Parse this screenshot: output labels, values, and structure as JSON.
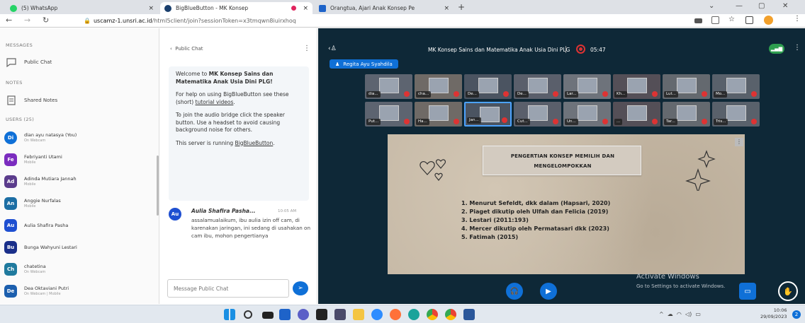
{
  "tabs": [
    {
      "title": "(5) WhatsApp",
      "color": "#25d366"
    },
    {
      "title": "BigBlueButton - MK Konsep",
      "color": "#1a3f6d"
    },
    {
      "title": "Orangtua, Ajari Anak Konsep Pe",
      "color": "#1e63c9"
    }
  ],
  "new_tab": "+",
  "url": {
    "host": "uscamz-1.unsri.ac.id",
    "path": "/html5client/join?sessionToken=x3tmqwn8iuirxhoq"
  },
  "sidebar": {
    "messages_label": "MESSAGES",
    "public_chat": "Public Chat",
    "notes_label": "NOTES",
    "shared_notes": "Shared Notes",
    "users_label": "USERS (25)",
    "users": [
      {
        "initials": "Di",
        "name": "dian ayu natasya (You)",
        "sub": "On Webcam",
        "color": "#0f70d7"
      },
      {
        "initials": "Fe",
        "name": "Febriyanti Utami",
        "sub": "Mobile",
        "color": "#7b2cbf"
      },
      {
        "initials": "Ad",
        "name": "Adinda Mutiara Jannah",
        "sub": "Mobile",
        "color": "#5b3c8c"
      },
      {
        "initials": "An",
        "name": "Anggie Nurfalas",
        "sub": "Mobile",
        "color": "#1c6ea4"
      },
      {
        "initials": "Au",
        "name": "Aulia Shafira Pasha",
        "sub": "",
        "color": "#1e4fd1"
      },
      {
        "initials": "Bu",
        "name": "Bunga Wahyuni Lestari",
        "sub": "",
        "color": "#1a2f8a"
      },
      {
        "initials": "Ch",
        "name": "chatetina",
        "sub": "On Webcam",
        "color": "#1f7a9e"
      },
      {
        "initials": "De",
        "name": "Dea Oktaviani Putri",
        "sub": "On Webcam | Mobile",
        "color": "#1c5fae"
      }
    ]
  },
  "chat": {
    "header": "Public Chat",
    "welcome1_pre": "Welcome to ",
    "welcome1_bold": "MK Konsep Sains dan Matematika Anak Usia Dini PLG",
    "welcome1_post": "!",
    "welcome2_pre": "For help on using BigBlueButton see these (short) ",
    "welcome2_link": "tutorial videos",
    "welcome2_post": ".",
    "welcome3": "To join the audio bridge click the speaker button. Use a headset to avoid causing background noise for others.",
    "welcome4_pre": "This server is running ",
    "welcome4_link": "BigBlueButton",
    "welcome4_post": ".",
    "msg_initials": "Au",
    "msg_name": "Aulia Shafira Pasha...",
    "msg_time": "10:05 AM",
    "msg_text": "assalamualaikum, ibu aulia izin off cam, di karenakan jaringan, ini sedang di usahakan on cam ibu, mohon pengertianya",
    "input_placeholder": "Message Public Chat"
  },
  "meeting": {
    "title": "MK Konsep Sains dan Matematika Anak Usia Dini PLG",
    "rec_time": "05:47",
    "presenter": "Regita Ayu Syahdila",
    "tiles": [
      "dia...",
      "cha...",
      "De...",
      "De...",
      "Lar...",
      "Kh...",
      "Lut...",
      "Mo...",
      "Put...",
      "Ha...",
      "Jan...",
      "Cut...",
      "Un...",
      "...",
      "Tar...",
      "Tris..."
    ],
    "slide_title1": "PENGERTIAN KONSEP MEMILIH DAN",
    "slide_title2": "MENGELOMPOKKAN",
    "slide_items": [
      "1. Menurut Sefeldt, dkk dalam (Hapsari, 2020)",
      "2. Piaget dikutip oleh Ulfah dan Felicia (2019)",
      "3. Lestari (2011:193)",
      "4. Mercer dikutip oleh Permatasari dkk (2023)",
      "5. Fatimah (2015)"
    ],
    "activate1": "Activate Windows",
    "activate2": "Go to Settings to activate Windows."
  },
  "taskbar": {
    "time": "10:06",
    "date": "29/09/2023"
  }
}
